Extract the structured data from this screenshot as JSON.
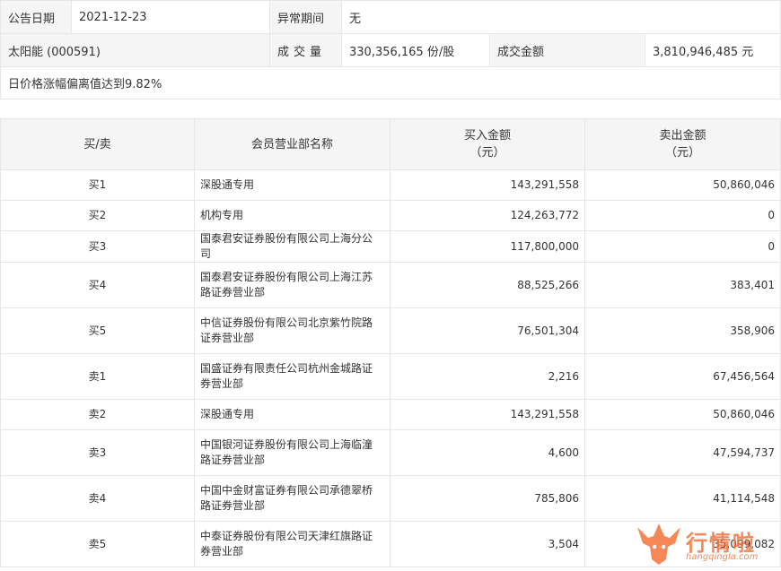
{
  "info": {
    "date_label": "公告日期",
    "date_value": "2021-12-23",
    "abnormal_label": "异常期间",
    "abnormal_value": "无",
    "stock": "太阳能 (000591)",
    "volume_label": "成交量",
    "volume_value": "330,356,165 份/股",
    "amount_label": "成交金额",
    "amount_value": "3,810,946,485 元",
    "reason": "日价格涨幅偏离值达到9.82%"
  },
  "list": {
    "headers": {
      "side": "买/卖",
      "branch": "会员营业部名称",
      "buy_line1": "买入金额",
      "buy_line2": "（元）",
      "sell_line1": "卖出金额",
      "sell_line2": "（元）"
    },
    "rows": [
      {
        "side": "买1",
        "branch": "深股通专用",
        "buy": "143,291,558",
        "sell": "50,860,046"
      },
      {
        "side": "买2",
        "branch": "机构专用",
        "buy": "124,263,772",
        "sell": "0"
      },
      {
        "side": "买3",
        "branch": "国泰君安证券股份有限公司上海分公司",
        "buy": "117,800,000",
        "sell": "0"
      },
      {
        "side": "买4",
        "branch": "国泰君安证券股份有限公司上海江苏路证券营业部",
        "buy": "88,525,266",
        "sell": "383,401"
      },
      {
        "side": "买5",
        "branch": "中信证券股份有限公司北京紫竹院路证券营业部",
        "buy": "76,501,304",
        "sell": "358,906"
      },
      {
        "side": "卖1",
        "branch": "国盛证券有限责任公司杭州金城路证券营业部",
        "buy": "2,216",
        "sell": "67,456,564"
      },
      {
        "side": "卖2",
        "branch": "深股通专用",
        "buy": "143,291,558",
        "sell": "50,860,046"
      },
      {
        "side": "卖3",
        "branch": "中国银河证券股份有限公司上海临潼路证券营业部",
        "buy": "4,600",
        "sell": "47,594,737"
      },
      {
        "side": "卖4",
        "branch": "中国中金财富证券有限公司承德翠桥路证券营业部",
        "buy": "785,806",
        "sell": "41,114,548"
      },
      {
        "side": "卖5",
        "branch": "中泰证券股份有限公司天津红旗路证券营业部",
        "buy": "3,504",
        "sell": "35,099,082"
      }
    ]
  },
  "watermark": {
    "brand": "行情啦",
    "site": "hangqingla.com",
    "color": "#f4733b",
    "icon": "bull-head-logo"
  }
}
